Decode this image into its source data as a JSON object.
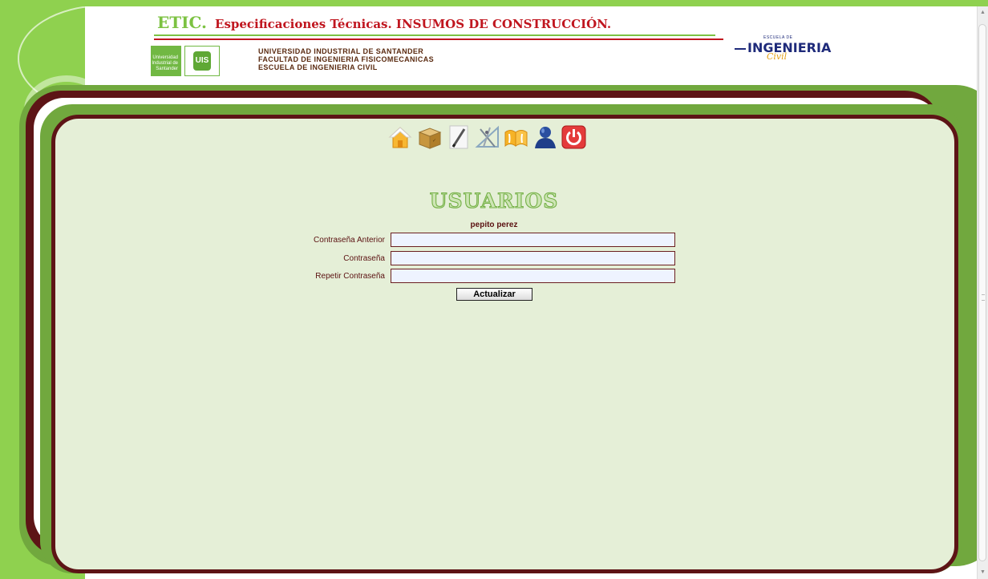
{
  "header": {
    "brand": "ETIC.",
    "subtitle": "Especificaciones Técnicas. INSUMOS DE CONSTRUCCIÓN.",
    "institution_lines": [
      "UNIVERSIDAD INDUSTRIAL DE SANTANDER",
      "FACULTAD DE INGENIERIA FISICOMECANICAS",
      "ESCUELA DE INGENIERIA CIVIL"
    ],
    "uis_logo_text": [
      "Universidad",
      "Industrial de",
      "Santander"
    ],
    "uis_badge": "UIS",
    "logo_right": {
      "top": "ESCUELA DE",
      "word": "INGENIERIA",
      "script": "Civil"
    }
  },
  "toolbar": {
    "icons": [
      "home-icon",
      "box-icon",
      "pencil-icon",
      "drafting-icon",
      "books-icon",
      "user-icon",
      "power-icon"
    ]
  },
  "page": {
    "title": "USUARIOS",
    "user_name": "pepito perez"
  },
  "form": {
    "fields": [
      {
        "label": "Contraseña Anterior",
        "value": ""
      },
      {
        "label": "Contraseña",
        "value": ""
      },
      {
        "label": "Repetir Contraseña",
        "value": ""
      }
    ],
    "submit_label": "Actualizar"
  },
  "colors": {
    "green": "#8fd14f",
    "maroon": "#5d1416",
    "panel": "#e5efd7",
    "brand_red": "#c0161f"
  }
}
